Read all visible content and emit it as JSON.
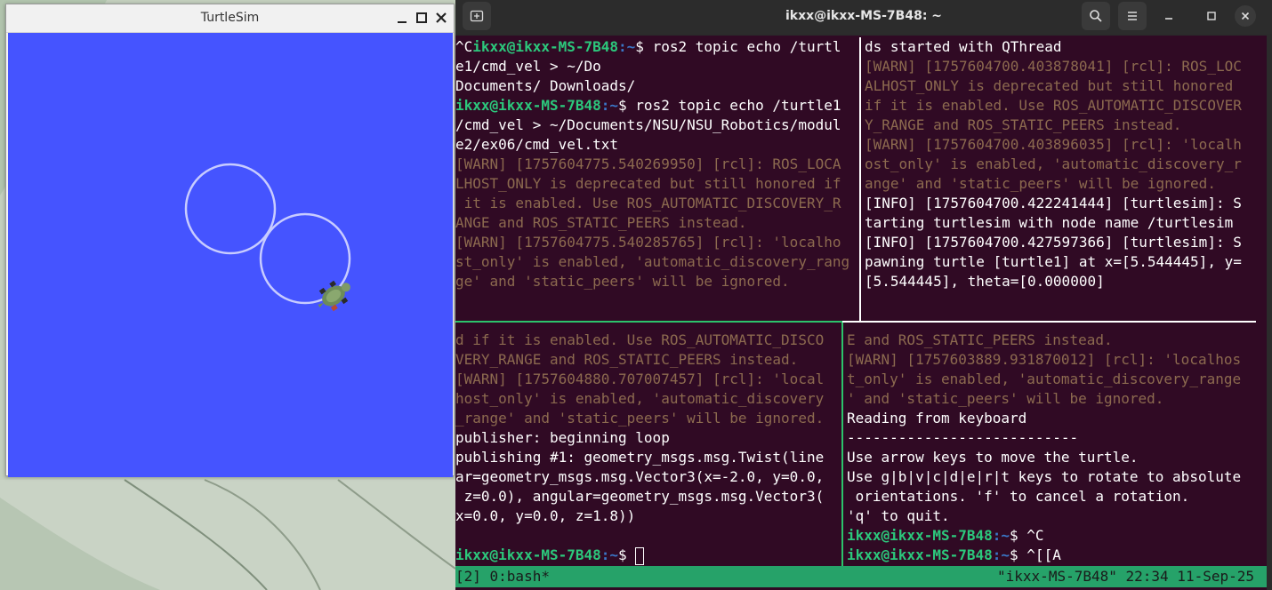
{
  "turtlesim": {
    "title": "TurtleSim",
    "background_color": "#4554ff",
    "trail_color": "#c8ccff"
  },
  "terminal": {
    "title": "ikxx@ikxx-MS-7B48: ~",
    "colors": {
      "background": "#300a24",
      "user": "#2cc87c",
      "path": "#3a77c8",
      "warn": "#8c6a4f",
      "status_bar": "#26a269"
    },
    "pane_top_left": [
      {
        "type": "cmd",
        "pre": "^C",
        "user": "ikxx@ikxx-MS-7B48",
        "path": ":~",
        "text": "$ ros2 topic echo /turtl"
      },
      {
        "type": "plain",
        "text": "e1/cmd_vel > ~/Do"
      },
      {
        "type": "plain",
        "text": "Documents/ Downloads/"
      },
      {
        "type": "cmd",
        "pre": "",
        "user": "ikxx@ikxx-MS-7B48",
        "path": ":~",
        "text": "$ ros2 topic echo /turtle1"
      },
      {
        "type": "plain",
        "text": "/cmd_vel > ~/Documents/NSU/NSU_Robotics/modul"
      },
      {
        "type": "plain",
        "text": "e2/ex06/cmd_vel.txt"
      },
      {
        "type": "warn",
        "text": "[WARN] [1757604775.540269950] [rcl]: ROS_LOCA"
      },
      {
        "type": "warn",
        "text": "LHOST_ONLY is deprecated but still honored if"
      },
      {
        "type": "warn",
        "text": " it is enabled. Use ROS_AUTOMATIC_DISCOVERY_R"
      },
      {
        "type": "warn",
        "text": "ANGE and ROS_STATIC_PEERS instead."
      },
      {
        "type": "warn",
        "text": "[WARN] [1757604775.540285765] [rcl]: 'localho"
      },
      {
        "type": "warn",
        "text": "st_only' is enabled, 'automatic_discovery_rang"
      },
      {
        "type": "warn",
        "text": "ge' and 'static_peers' will be ignored."
      }
    ],
    "pane_top_right": [
      {
        "type": "plain",
        "text": "ds started with QThread"
      },
      {
        "type": "warn",
        "text": "[WARN] [1757604700.403878041] [rcl]: ROS_LOC"
      },
      {
        "type": "warn",
        "text": "ALHOST_ONLY is deprecated but still honored"
      },
      {
        "type": "warn",
        "text": "if it is enabled. Use ROS_AUTOMATIC_DISCOVER"
      },
      {
        "type": "warn",
        "text": "Y_RANGE and ROS_STATIC_PEERS instead."
      },
      {
        "type": "warn",
        "text": "[WARN] [1757604700.403896035] [rcl]: 'localh"
      },
      {
        "type": "warn",
        "text": "ost_only' is enabled, 'automatic_discovery_r"
      },
      {
        "type": "warn",
        "text": "ange' and 'static_peers' will be ignored."
      },
      {
        "type": "plain",
        "text": "[INFO] [1757604700.422241444] [turtlesim]: S"
      },
      {
        "type": "plain",
        "text": "tarting turtlesim with node name /turtlesim"
      },
      {
        "type": "plain",
        "text": "[INFO] [1757604700.427597366] [turtlesim]: S"
      },
      {
        "type": "plain",
        "text": "pawning turtle [turtle1] at x=[5.544445], y="
      },
      {
        "type": "plain",
        "text": "[5.544445], theta=[0.000000]"
      }
    ],
    "pane_bottom_left": [
      {
        "type": "warn",
        "text": "d if it is enabled. Use ROS_AUTOMATIC_DISCO"
      },
      {
        "type": "warn",
        "text": "VERY_RANGE and ROS_STATIC_PEERS instead."
      },
      {
        "type": "warn",
        "text": "[WARN] [1757604880.707007457] [rcl]: 'local"
      },
      {
        "type": "warn",
        "text": "host_only' is enabled, 'automatic_discovery"
      },
      {
        "type": "warn",
        "text": "_range' and 'static_peers' will be ignored."
      },
      {
        "type": "plain",
        "text": "publisher: beginning loop"
      },
      {
        "type": "plain",
        "text": "publishing #1: geometry_msgs.msg.Twist(line"
      },
      {
        "type": "plain",
        "text": "ar=geometry_msgs.msg.Vector3(x=-2.0, y=0.0,"
      },
      {
        "type": "plain",
        "text": " z=0.0), angular=geometry_msgs.msg.Vector3("
      },
      {
        "type": "plain",
        "text": "x=0.0, y=0.0, z=1.8))"
      },
      {
        "type": "plain",
        "text": ""
      },
      {
        "type": "cmd",
        "pre": "",
        "user": "ikxx@ikxx-MS-7B48",
        "path": ":~",
        "text": "$ ",
        "cursor": true
      }
    ],
    "pane_bottom_right": [
      {
        "type": "warn",
        "text": "E and ROS_STATIC_PEERS instead."
      },
      {
        "type": "warn",
        "text": "[WARN] [1757603889.931870012] [rcl]: 'localhos"
      },
      {
        "type": "warn",
        "text": "t_only' is enabled, 'automatic_discovery_range"
      },
      {
        "type": "warn",
        "text": "' and 'static_peers' will be ignored."
      },
      {
        "type": "plain",
        "text": "Reading from keyboard"
      },
      {
        "type": "plain",
        "text": "---------------------------"
      },
      {
        "type": "plain",
        "text": "Use arrow keys to move the turtle."
      },
      {
        "type": "plain",
        "text": "Use g|b|v|c|d|e|r|t keys to rotate to absolute"
      },
      {
        "type": "plain",
        "text": " orientations. 'f' to cancel a rotation."
      },
      {
        "type": "plain",
        "text": "'q' to quit."
      },
      {
        "type": "cmd",
        "pre": "",
        "user": "ikxx@ikxx-MS-7B48",
        "path": ":~",
        "text": "$ ^C"
      },
      {
        "type": "cmd",
        "pre": "",
        "user": "ikxx@ikxx-MS-7B48",
        "path": ":~",
        "text": "$ ^[[A"
      }
    ],
    "status_left": "[2] 0:bash*",
    "status_right": "\"ikxx-MS-7B48\" 22:34 11-Sep-25"
  },
  "icons": {
    "new_tab": "new-tab-icon",
    "search": "search-icon",
    "menu": "hamburger-menu-icon",
    "minimize": "minimize-icon",
    "maximize": "maximize-icon",
    "close": "close-icon"
  }
}
